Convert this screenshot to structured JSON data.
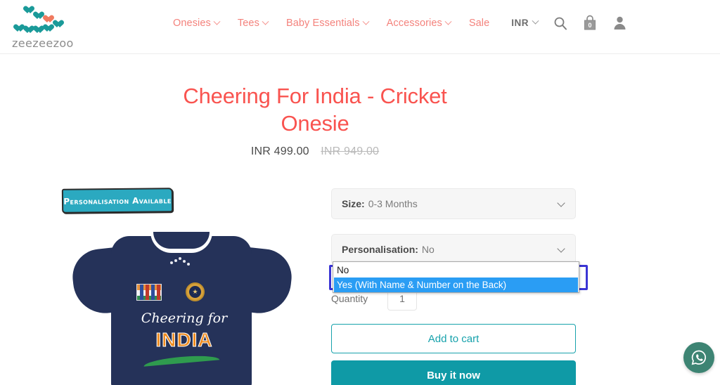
{
  "header": {
    "logo": {
      "text": "zeezeezoo",
      "icon": "hearts-logo-icon"
    },
    "nav": [
      {
        "label": "Onesies",
        "has_dropdown": true
      },
      {
        "label": "Tees",
        "has_dropdown": true
      },
      {
        "label": "Baby Essentials",
        "has_dropdown": true
      },
      {
        "label": "Accessories",
        "has_dropdown": true
      },
      {
        "label": "Sale",
        "has_dropdown": false
      }
    ],
    "currency": {
      "label": "INR"
    },
    "search_icon": "search-icon",
    "cart": {
      "icon": "cart-bag-icon",
      "count": "0"
    },
    "account_icon": "account-person-icon"
  },
  "product": {
    "title": "Cheering For India - Cricket Onesie",
    "price_current": "INR 499.00",
    "price_compare": "INR 949.00",
    "badge": "Personalisation Available",
    "tee_script": "Cheering for",
    "tee_india": "INDIA"
  },
  "form": {
    "size": {
      "label": "Size:",
      "value": "0-3 Months"
    },
    "personalisation": {
      "label": "Personalisation:",
      "value": "No",
      "open": true,
      "options": [
        {
          "label": "No",
          "selected": false
        },
        {
          "label": "Yes (With Name & Number on the Back)",
          "selected": true
        }
      ]
    },
    "quantity": {
      "label": "Quantity",
      "value": "1"
    },
    "add_to_cart": "Add to cart",
    "buy_now": "Buy it now"
  },
  "whatsapp": {
    "icon": "whatsapp-icon"
  },
  "colors": {
    "brand_coral": "#f4827c",
    "title_red": "#f9534f",
    "teal": "#0f9aa6",
    "logo_teal": "#1a9a99",
    "logo_coral": "#f07a5f",
    "badge_teal": "#2ba9c0",
    "option_highlight": "#2a9df4",
    "focus_ring": "#3b35d4",
    "whatsapp_green": "#3d8473"
  }
}
